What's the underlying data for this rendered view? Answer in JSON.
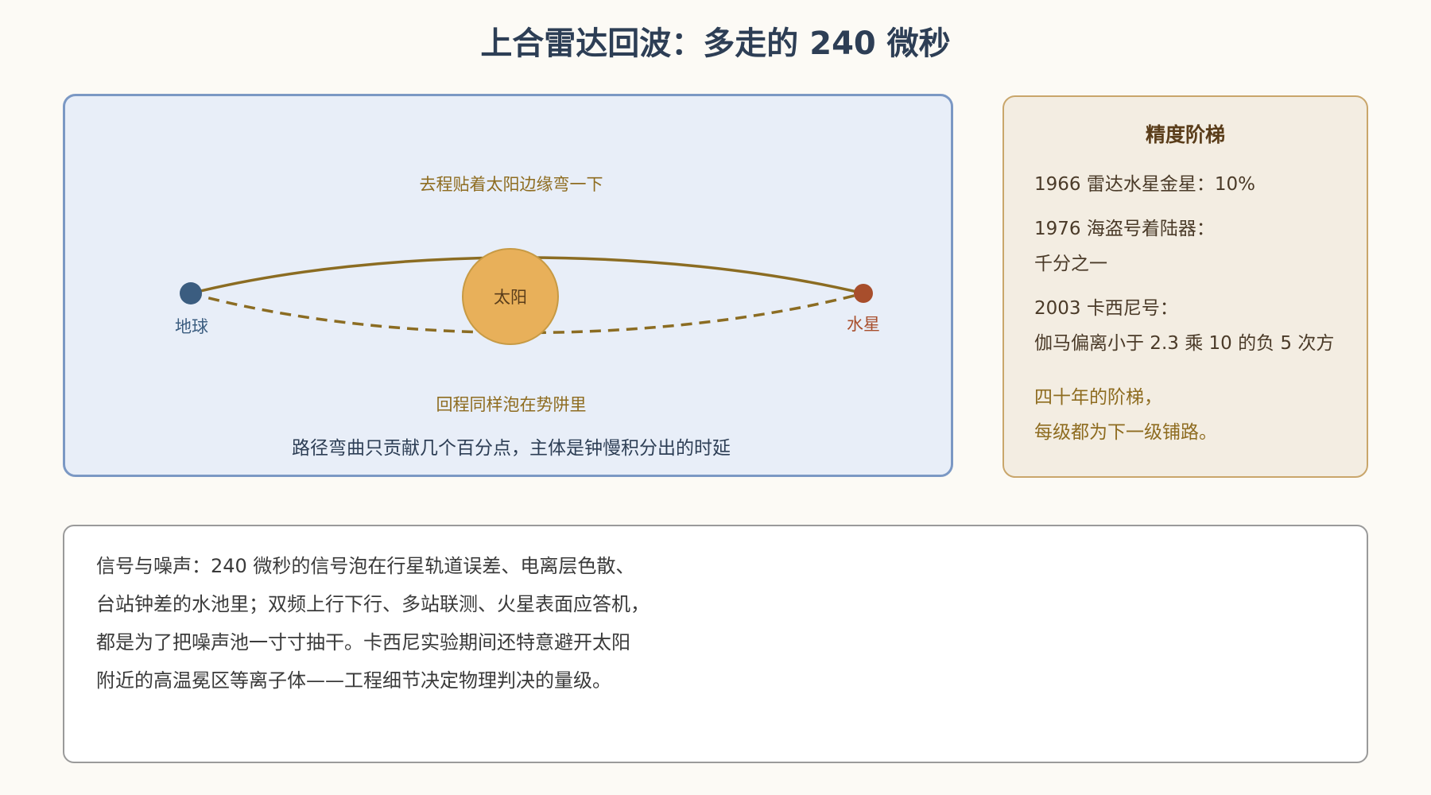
{
  "title": "上合雷达回波：多走的 240 微秒",
  "diagram": {
    "earth_label": "地球",
    "sun_label": "太阳",
    "mercury_label": "水星",
    "outbound_caption": "去程贴着太阳边缘弯一下",
    "return_caption": "回程同样泡在势阱里",
    "note": "路径弯曲只贡献几个百分点，主体是钟慢积分出的时延",
    "colors": {
      "earth": "#3b5d80",
      "sun": "#e8b05a",
      "mercury": "#a84e2c",
      "path": "#8b6c22",
      "caption": "#8e6c20"
    }
  },
  "ladder": {
    "title": "精度阶梯",
    "lines": [
      "1966 雷达水星金星：10%",
      "1976 海盗号着陆器：",
      "千分之一",
      "2003 卡西尼号：",
      "伽马偏离小于 2.3 乘 10 的负 5 次方"
    ],
    "closing": [
      "四十年的阶梯，",
      "每级都为下一级铺路。"
    ]
  },
  "notes": {
    "lines": [
      "信号与噪声：240 微秒的信号泡在行星轨道误差、电离层色散、",
      "台站钟差的水池里；双频上行下行、多站联测、火星表面应答机，",
      "都是为了把噪声池一寸寸抽干。卡西尼实验期间还特意避开太阳",
      "附近的高温冕区等离子体——工程细节决定物理判决的量级。"
    ]
  }
}
